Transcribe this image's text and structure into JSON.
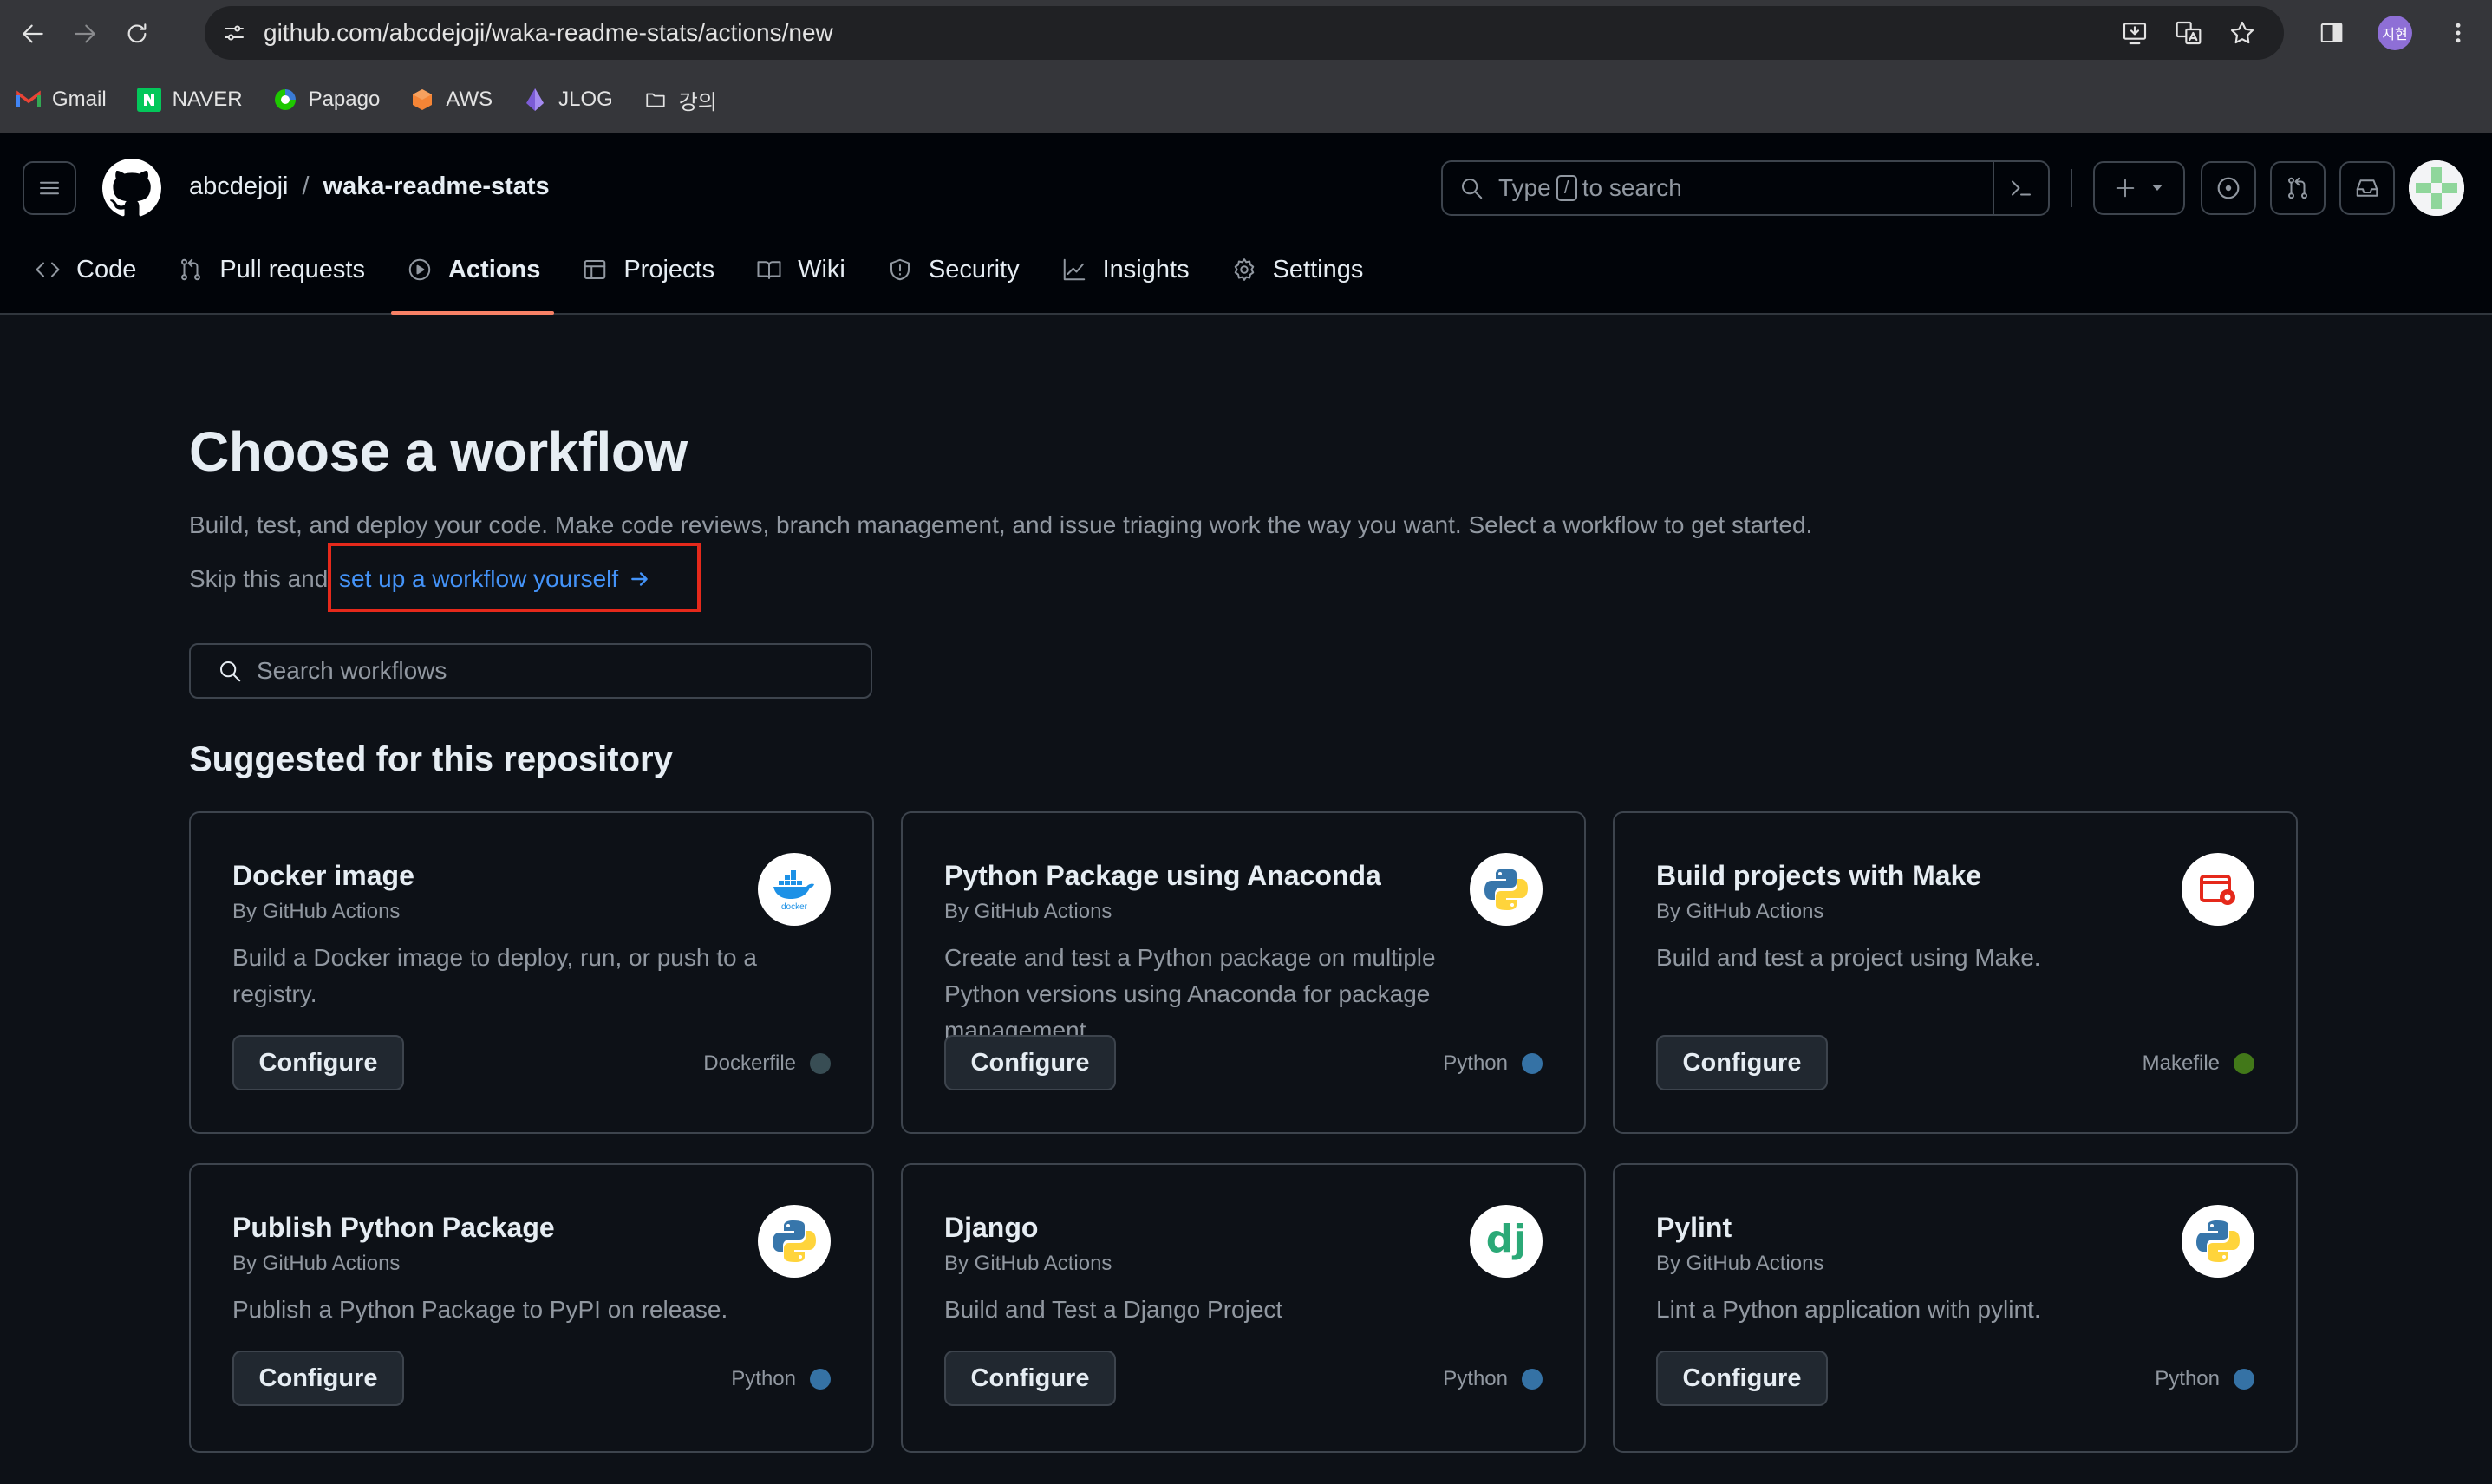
{
  "browser": {
    "url": "github.com/abcdejoji/waka-readme-stats/actions/new",
    "profile_initials": "지현",
    "bookmarks": [
      {
        "label": "Gmail",
        "icon": "gmail-icon"
      },
      {
        "label": "NAVER",
        "icon": "naver-icon"
      },
      {
        "label": "Papago",
        "icon": "papago-icon"
      },
      {
        "label": "AWS",
        "icon": "aws-icon"
      },
      {
        "label": "JLOG",
        "icon": "jlog-icon"
      },
      {
        "label": "강의",
        "icon": "folder-icon"
      }
    ]
  },
  "header": {
    "owner": "abcdejoji",
    "separator": "/",
    "repo": "waka-readme-stats",
    "search_prefix": "Type",
    "search_key": "/",
    "search_suffix": "to search"
  },
  "repo_nav": {
    "tabs": [
      {
        "label": "Code",
        "icon": "code-icon"
      },
      {
        "label": "Pull requests",
        "icon": "git-pull-request-icon"
      },
      {
        "label": "Actions",
        "icon": "play-icon",
        "active": true
      },
      {
        "label": "Projects",
        "icon": "table-icon"
      },
      {
        "label": "Wiki",
        "icon": "book-icon"
      },
      {
        "label": "Security",
        "icon": "shield-icon"
      },
      {
        "label": "Insights",
        "icon": "graph-icon"
      },
      {
        "label": "Settings",
        "icon": "gear-icon"
      }
    ]
  },
  "main": {
    "title": "Choose a workflow",
    "description": "Build, test, and deploy your code. Make code reviews, branch management, and issue triaging work the way you want. Select a workflow to get started.",
    "skip_text": "Skip this and",
    "setup_link": "set up a workflow yourself",
    "search_placeholder": "Search workflows",
    "section_title": "Suggested for this repository",
    "highlight_color": "#e5291b"
  },
  "cards": [
    {
      "title": "Docker image",
      "author": "By GitHub Actions",
      "description": "Build a Docker image to deploy, run, or push to a registry.",
      "button": "Configure",
      "language": "Dockerfile",
      "language_color": "#384d54",
      "logo": "docker-logo",
      "logo_text": "docker"
    },
    {
      "title": "Python Package using Anaconda",
      "author": "By GitHub Actions",
      "description": "Create and test a Python package on multiple Python versions using Anaconda for package management.",
      "button": "Configure",
      "language": "Python",
      "language_color": "#3572a5",
      "logo": "python-logo"
    },
    {
      "title": "Build projects with Make",
      "author": "By GitHub Actions",
      "description": "Build and test a project using Make.",
      "button": "Configure",
      "language": "Makefile",
      "language_color": "#427819",
      "logo": "make-logo"
    },
    {
      "title": "Publish Python Package",
      "author": "By GitHub Actions",
      "description": "Publish a Python Package to PyPI on release.",
      "button": "Configure",
      "language": "Python",
      "language_color": "#3572a5",
      "logo": "python-logo"
    },
    {
      "title": "Django",
      "author": "By GitHub Actions",
      "description": "Build and Test a Django Project",
      "button": "Configure",
      "language": "Python",
      "language_color": "#3572a5",
      "logo": "django-logo",
      "logo_text": "dj"
    },
    {
      "title": "Pylint",
      "author": "By GitHub Actions",
      "description": "Lint a Python application with pylint.",
      "button": "Configure",
      "language": "Python",
      "language_color": "#3572a5",
      "logo": "python-logo"
    }
  ]
}
